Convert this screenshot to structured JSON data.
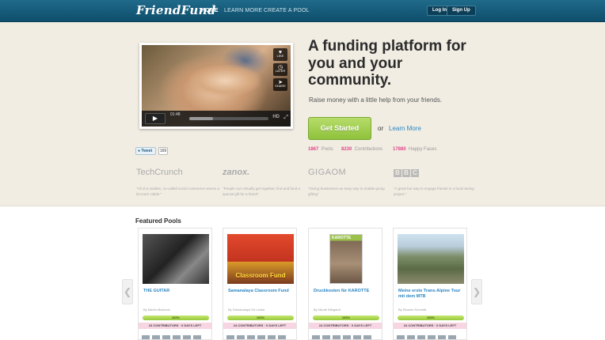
{
  "header": {
    "logo": "FriendFund",
    "nav": [
      "HOME",
      "LEARN MORE",
      "CREATE A POOL"
    ],
    "login": "Log In",
    "signup": "Sign Up"
  },
  "video": {
    "time": "01:48",
    "side": [
      "LIKE",
      "LATER",
      "SHARE"
    ],
    "hd": "HD"
  },
  "hero": {
    "headline": "A funding platform for you and your community.",
    "subline": "Raise money with a little help from your friends.",
    "cta": "Get Started",
    "or": "or",
    "learn_more": "Learn More",
    "stats": [
      {
        "value": "1867",
        "label": "Pools",
        "color": "#e0458a"
      },
      {
        "value": "8230",
        "label": "Contributions",
        "color": "#e0458a"
      },
      {
        "value": "17880",
        "label": "Happy Faces",
        "color": "#e0458a"
      }
    ]
  },
  "social": {
    "tweet": "Tweet",
    "tweet_count": "169"
  },
  "press": [
    {
      "name": "TechCrunch",
      "quote": "\"All of a sudden, so-called social commerce seems a lot more viable.\""
    },
    {
      "name": "zanox.",
      "quote": "\"People can virtually get together, find and fund a special gift for a friend\""
    },
    {
      "name": "GIGAOM",
      "quote": "\"Giving businesses an easy way to enable group gifting\""
    },
    {
      "name": "BBC",
      "quote": "\"A great fun way to engage friends in a fund raising project.\""
    }
  ],
  "featured": {
    "title": "Featured Pools",
    "pools": [
      {
        "title": "THE GUITAR",
        "by": "By Martin Markovic",
        "progress_label": "100%",
        "progress": 1.0,
        "contrib": "23 CONTRIBUTORS · 0 DAYS LEFT"
      },
      {
        "title": "Samanalaya Classroom Fund",
        "by": "By Samanalaya Sri Lanka",
        "progress_label": "100%",
        "progress": 1.0,
        "contrib": "24 CONTRIBUTORS · 0 DAYS LEFT",
        "image_text": "Classroom Fund"
      },
      {
        "title": "Druckkosten für KAROTTE",
        "by": "By Nicole Wiegand",
        "progress_label": "100%",
        "progress": 1.0,
        "contrib": "24 CONTRIBUTORS · 0 DAYS LEFT",
        "image_text": "KAROTTE"
      },
      {
        "title": "Meine erste Trans-Alpine Tour mit dem MTB",
        "by": "By Ricardo Schmidt",
        "progress_label": "100%",
        "progress": 1.0,
        "contrib": "24 CONTRIBUTORS · 0 DAYS LEFT"
      }
    ]
  },
  "colors": {
    "nav_bg": "#15607f",
    "accent_green": "#8fc23b",
    "link_blue": "#2a86c2",
    "stat_pink": "#e0458a"
  }
}
